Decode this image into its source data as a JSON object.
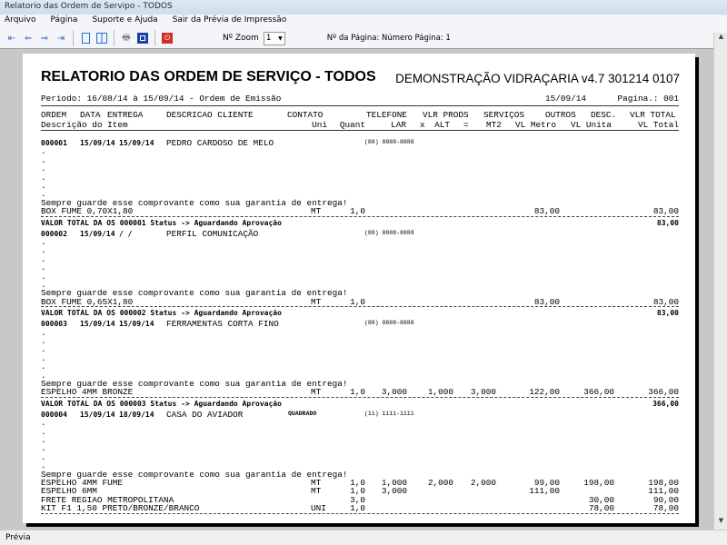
{
  "window": {
    "title": "Relatorio das Ordem de Servipo - TODOS"
  },
  "menu": [
    "Arquivo",
    "Página",
    "Suporte e Ajuda",
    "Sair da Prévia de Impressão"
  ],
  "toolbar": {
    "zoom_label": "Nº Zoom",
    "zoom_value": "1",
    "page_label": "Nº da Página: Número Página: 1",
    "icons": [
      "first-page-icon",
      "prev-page-icon",
      "next-page-icon",
      "last-page-icon",
      "single-page-icon",
      "two-page-icon",
      "print-icon",
      "export-icon",
      "close-red-icon"
    ]
  },
  "status": {
    "text": "Prévia"
  },
  "report": {
    "title": "RELATORIO DAS ORDEM DE SERVIÇO - TODOS",
    "company": "DEMONSTRAÇÃO VIDRAÇARIA v4.7 301214 0107",
    "period": "Periodo: 16/08/14 à 15/09/14 - Ordem de Emissão",
    "date": "15/09/14",
    "page": "Pagina.: 001",
    "header1": {
      "ordem": "ORDEM",
      "data": "DATA",
      "entrega": "ENTREGA",
      "cliente": "DESCRICAO CLIENTE",
      "contato": "CONTATO",
      "telefone": "TELEFONE",
      "vlr_prods": "VLR PRODS",
      "servicos": "SERVIÇOS",
      "outros": "OUTROS",
      "desc": "DESC.",
      "vlr_total": "VLR TOTAL"
    },
    "header2": {
      "descricao": "Descrição do Item",
      "uni": "Uni",
      "quant": "Quant",
      "lar": "LAR",
      "x": "x",
      "alt": "ALT",
      "eq": "=",
      "mt2": "MT2",
      "vl_metro": "VL Metro",
      "vl_unita": "VL Unita",
      "vl_total": "VL Total"
    },
    "guarantee": "Sempre guarde esse comprovante como sua garantia de entrega!",
    "orders": [
      {
        "num": "000001",
        "data": "15/09/14",
        "entrega": "15/09/14",
        "cliente": "PEDRO CARDOSO DE MELO",
        "contato": "",
        "telefone": "(88) 8888-8888",
        "dots": 6,
        "items": [
          {
            "desc": "BOX FUME 0,70X1,80",
            "uni": "MT",
            "quant": "1,0",
            "lar": "",
            "alt": "",
            "mt2": "",
            "vl_metro": "83,00",
            "vl_unita": "",
            "vl_total": "83,00"
          }
        ],
        "total_label": "VALOR TOTAL DA OS 000001  Status -> Aguardando Aprovação",
        "total": "83,00"
      },
      {
        "num": "000002",
        "data": "15/09/14",
        "entrega": "  /  /",
        "cliente": "PERFIL COMUNICAÇÃO",
        "contato": "",
        "telefone": "(88) 8888-8888",
        "dots": 6,
        "items": [
          {
            "desc": "BOX FUME 0,65X1,80",
            "uni": "MT",
            "quant": "1,0",
            "lar": "",
            "alt": "",
            "mt2": "",
            "vl_metro": "83,00",
            "vl_unita": "",
            "vl_total": "83,00"
          }
        ],
        "total_label": "VALOR TOTAL DA OS 000002  Status -> Aguardando Aprovação",
        "total": "83,00"
      },
      {
        "num": "000003",
        "data": "15/09/14",
        "entrega": "15/09/14",
        "cliente": "FERRAMENTAS CORTA FINO",
        "contato": "",
        "telefone": "(88) 8888-8888",
        "dots": 6,
        "items": [
          {
            "desc": "ESPELHO 4MM BRONZE",
            "uni": "MT",
            "quant": "1,0",
            "lar": "3,000",
            "alt": "1,000",
            "mt2": "3,000",
            "vl_metro": "122,00",
            "vl_unita": "366,00",
            "vl_total": "366,00"
          }
        ],
        "total_label": "VALOR TOTAL DA OS 000003  Status -> Aguardando Aprovação",
        "total": "366,00"
      },
      {
        "num": "000004",
        "data": "15/09/14",
        "entrega": "18/09/14",
        "cliente": "CASA DO AVIADOR",
        "contato": "QUADRADO",
        "telefone": "(11) 1111-1111",
        "dots": 6,
        "items": [
          {
            "desc": "ESPELHO 4MM FUME",
            "uni": "MT",
            "quant": "1,0",
            "lar": "1,000",
            "alt": "2,000",
            "mt2": "2,000",
            "vl_metro": "99,00",
            "vl_unita": "198,00",
            "vl_total": "198,00"
          },
          {
            "desc": "ESPELHO 6MM",
            "uni": "MT",
            "quant": "1,0",
            "lar": "3,000",
            "alt": "",
            "mt2": "",
            "vl_metro": "111,00",
            "vl_unita": "",
            "vl_total": "111,00"
          },
          {
            "desc": "FRETE REGIAO METROPOLITANA",
            "uni": "",
            "quant": "3,0",
            "lar": "",
            "alt": "",
            "mt2": "",
            "vl_metro": "",
            "vl_unita": "30,00",
            "vl_total": "90,00"
          },
          {
            "desc": "KIT F1 1,50 PRETO/BRONZE/BRANCO",
            "uni": "UNI",
            "quant": "1,0",
            "lar": "",
            "alt": "",
            "mt2": "",
            "vl_metro": "",
            "vl_unita": "78,00",
            "vl_total": "78,00"
          }
        ],
        "total_label": "",
        "total": ""
      }
    ]
  }
}
